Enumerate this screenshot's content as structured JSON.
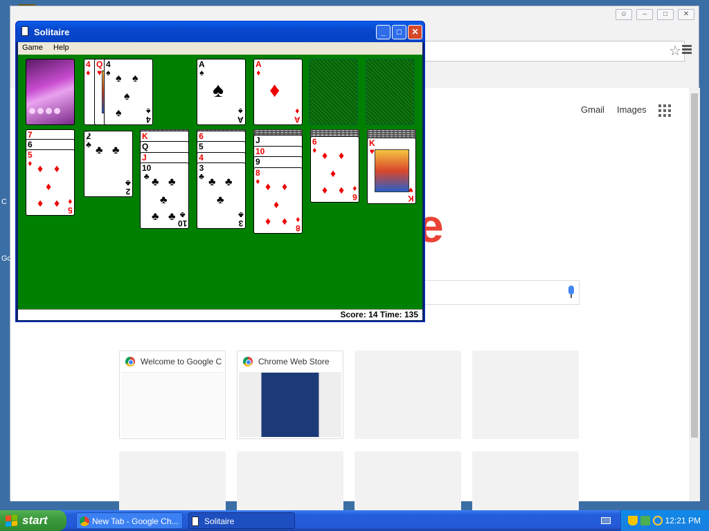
{
  "chrome": {
    "omnibox_placeholder": "",
    "top_links": [
      "Gmail",
      "Images"
    ],
    "logo_fragment": "e",
    "tiles": [
      {
        "title": "Welcome to Google C",
        "filled": true
      },
      {
        "title": "Chrome Web Store",
        "filled": true
      },
      {
        "title": "",
        "filled": false
      },
      {
        "title": "",
        "filled": false
      }
    ]
  },
  "desktop": {
    "left_fragments": [
      "C",
      "Go"
    ]
  },
  "solitaire": {
    "title": "Solitaire",
    "menu": [
      "Game",
      "Help"
    ],
    "status": "Score: 14 Time: 135",
    "cards": [
      {
        "rank": "4",
        "suit": "♦",
        "color": "red"
      },
      {
        "rank": "Q",
        "suit": "♥",
        "color": "red"
      },
      {
        "rank": "4",
        "suit": "♠",
        "color": "blk"
      },
      {
        "rank": "A",
        "suit": "♠",
        "color": "blk"
      },
      {
        "rank": "A",
        "suit": "♦",
        "color": "red"
      },
      {
        "rank": "7",
        "suit": "♦",
        "color": "red"
      },
      {
        "rank": "6",
        "suit": "♠",
        "color": "blk"
      },
      {
        "rank": "5",
        "suit": "♦",
        "color": "red"
      },
      {
        "rank": "2",
        "suit": "♣",
        "color": "blk"
      },
      {
        "rank": "K",
        "suit": "♥",
        "color": "red"
      },
      {
        "rank": "Q",
        "suit": "♣",
        "color": "blk"
      },
      {
        "rank": "J",
        "suit": "♦",
        "color": "red"
      },
      {
        "rank": "10",
        "suit": "♣",
        "color": "blk"
      },
      {
        "rank": "6",
        "suit": "♥",
        "color": "red"
      },
      {
        "rank": "5",
        "suit": "♠",
        "color": "blk"
      },
      {
        "rank": "4",
        "suit": "♥",
        "color": "red"
      },
      {
        "rank": "3",
        "suit": "♣",
        "color": "blk"
      },
      {
        "rank": "J",
        "suit": "♠",
        "color": "blk"
      },
      {
        "rank": "10",
        "suit": "♥",
        "color": "red"
      },
      {
        "rank": "9",
        "suit": "♠",
        "color": "blk"
      },
      {
        "rank": "8",
        "suit": "♦",
        "color": "red"
      },
      {
        "rank": "6",
        "suit": "♦",
        "color": "red"
      },
      {
        "rank": "K",
        "suit": "♥",
        "color": "red"
      }
    ]
  },
  "taskbar": {
    "start_label": "start",
    "tasks": [
      "New Tab - Google Ch...",
      "Solitaire"
    ],
    "clock": "12:21 PM"
  }
}
